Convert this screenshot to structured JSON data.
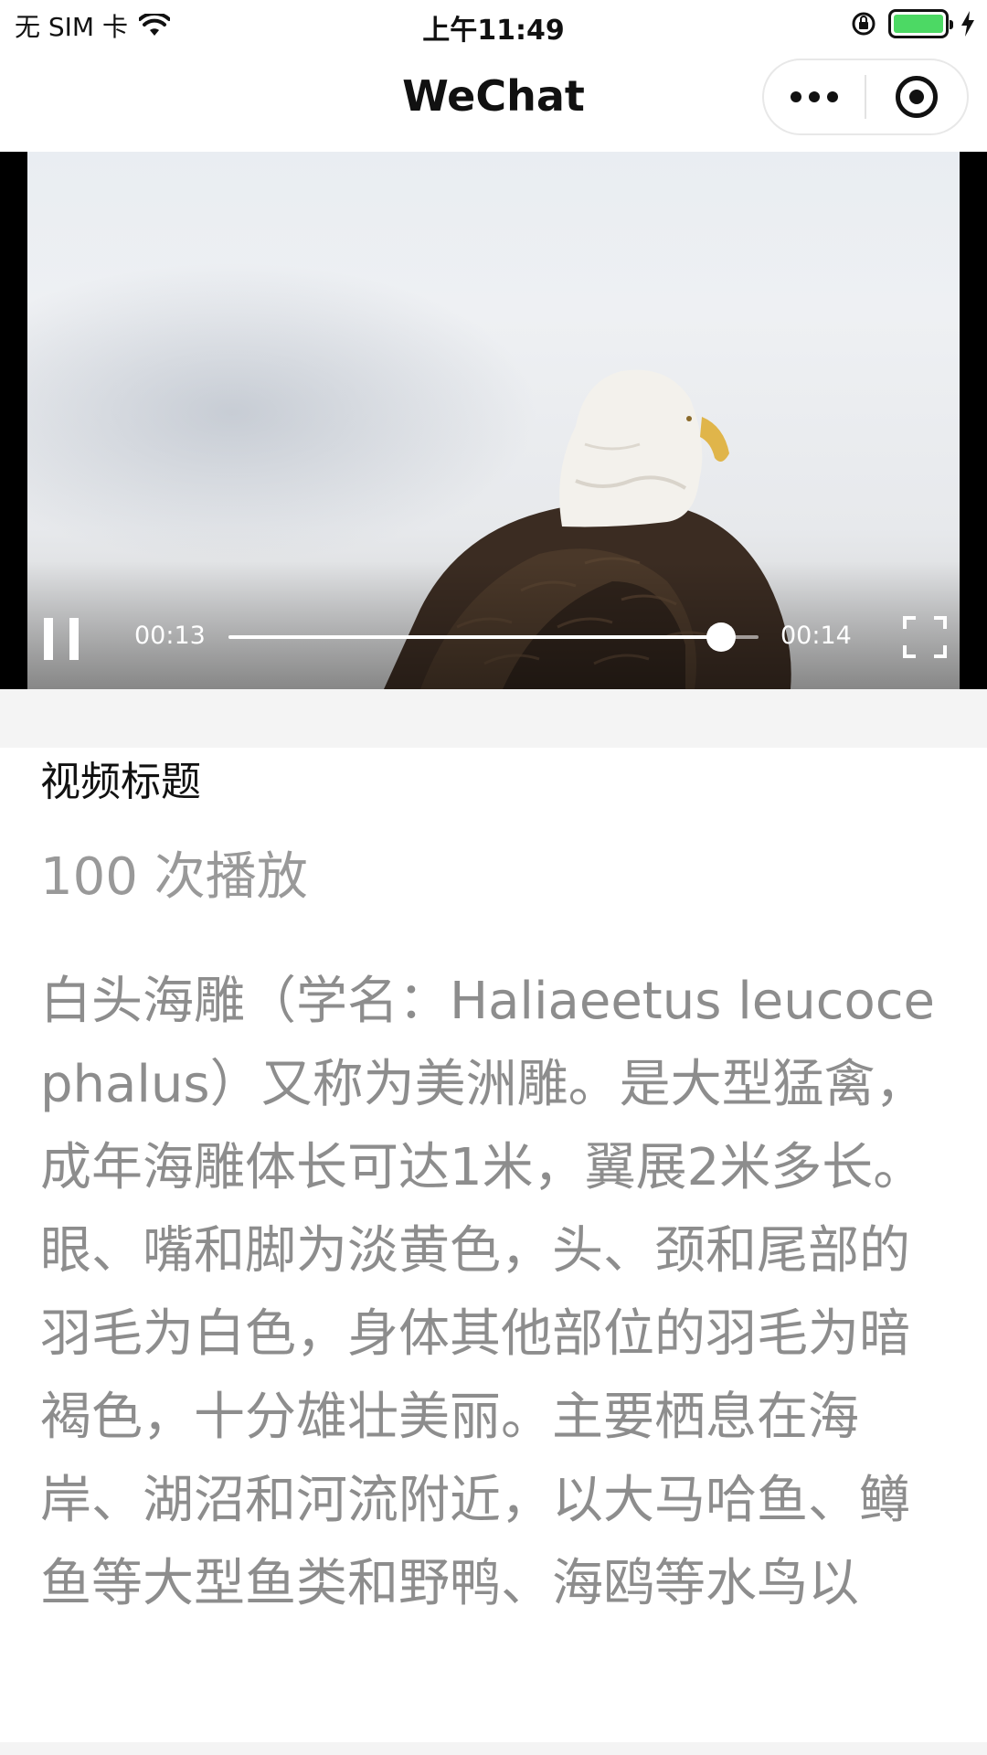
{
  "status_bar": {
    "carrier": "无 SIM 卡",
    "time": "上午11:49",
    "battery_color": "#4cd964"
  },
  "nav": {
    "title": "WeChat",
    "more_icon": "more-dots-icon",
    "close_icon": "target-circle-icon"
  },
  "video": {
    "current_time": "00:13",
    "duration": "00:14",
    "progress_fraction": 0.93,
    "state": "playing",
    "pause_icon": "pause-icon",
    "fullscreen_icon": "fullscreen-icon"
  },
  "content": {
    "title": "视频标题",
    "play_count": "100 次播放",
    "description": "白头海雕（学名：Haliaeetus leucocephalus）又称为美洲雕。是大型猛禽，成年海雕体长可达1米，翼展2米多长。眼、嘴和脚为淡黄色，头、颈和尾部的羽毛为白色，身体其他部位的羽毛为暗褐色，十分雄壮美丽。主要栖息在海岸、湖沼和河流附近，以大马哈鱼、鳟鱼等大型鱼类和野鸭、海鸥等水鸟以"
  }
}
